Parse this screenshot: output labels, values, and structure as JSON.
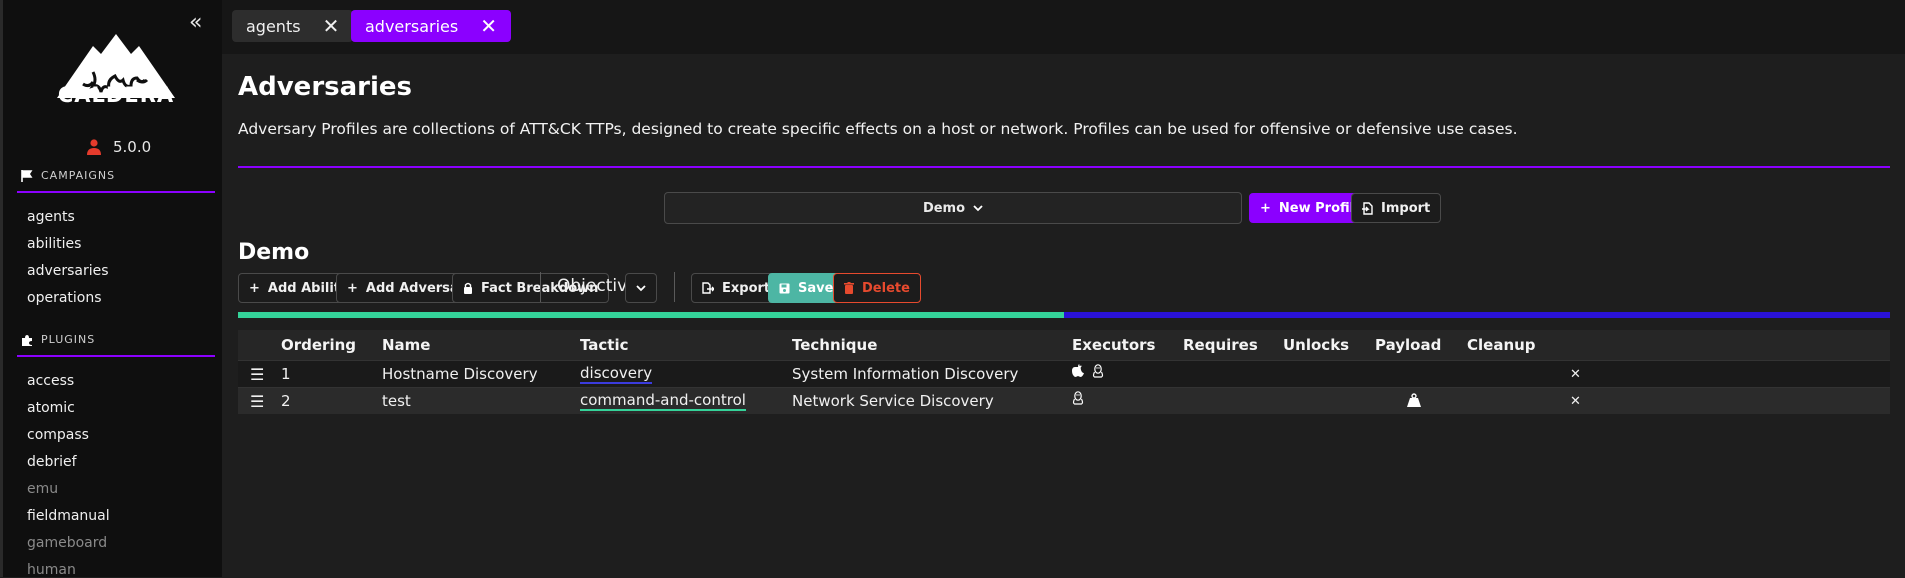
{
  "sidebar": {
    "logo_text": "CALDERA",
    "version": "5.0.0",
    "campaigns_title": "CAMPAIGNS",
    "campaign_items": [
      {
        "label": "agents"
      },
      {
        "label": "abilities"
      },
      {
        "label": "adversaries"
      },
      {
        "label": "operations"
      }
    ],
    "plugins_title": "PLUGINS",
    "plugin_items": [
      {
        "label": "access"
      },
      {
        "label": "atomic"
      },
      {
        "label": "compass"
      },
      {
        "label": "debrief"
      },
      {
        "label": "emu"
      },
      {
        "label": "fieldmanual"
      },
      {
        "label": "gameboard"
      },
      {
        "label": "human"
      }
    ]
  },
  "tabs": [
    {
      "label": "agents",
      "active": false
    },
    {
      "label": "adversaries",
      "active": true
    }
  ],
  "page": {
    "title": "Adversaries",
    "description": "Adversary Profiles are collections of ATT&CK TTPs, designed to create specific effects on a host or network. Profiles can be used for offensive or defensive use cases."
  },
  "profile_select": {
    "value": "Demo"
  },
  "buttons": {
    "new_profile": "New Profile",
    "import": "Import",
    "add_ability": "Add Ability",
    "add_adversary": "Add Adversary",
    "fact_breakdown": "Fact Breakdown",
    "objective_label": "Objective:",
    "export": "Export",
    "save": "Save",
    "delete": "Delete"
  },
  "profile": {
    "name": "Demo",
    "description": "---"
  },
  "progress": {
    "fraction": 0.5
  },
  "table": {
    "headers": [
      "Ordering",
      "Name",
      "Tactic",
      "Technique",
      "Executors",
      "Requires",
      "Unlocks",
      "Payload",
      "Cleanup"
    ],
    "rows": [
      {
        "ordering": "1",
        "name": "Hostname Discovery",
        "tactic": "discovery",
        "technique": "System Information Discovery",
        "executors": [
          "apple-icon",
          "linux-icon"
        ],
        "payload": false
      },
      {
        "ordering": "2",
        "name": "test",
        "tactic": "command-and-control",
        "technique": "Network Service Discovery",
        "executors": [
          "linux-icon"
        ],
        "payload": true
      }
    ]
  },
  "colors": {
    "accent": "#8b00ff",
    "save": "#4db6a4",
    "delete": "#e64a2e",
    "progress_done": "#34d399",
    "progress_rest": "#2a12d8"
  }
}
